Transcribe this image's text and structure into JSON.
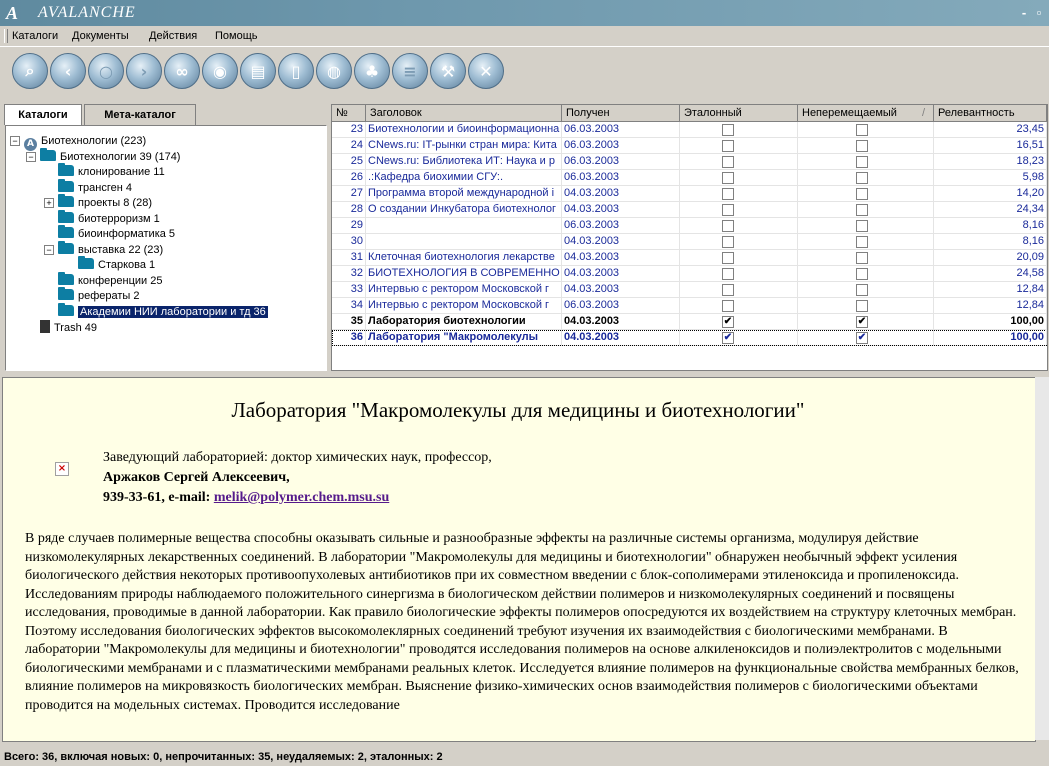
{
  "window": {
    "title": "AVALANCHE",
    "logo": "A",
    "minimize": "-",
    "restore": "▫"
  },
  "menu": [
    "Каталоги",
    "Документы",
    "Действия",
    "Помощь"
  ],
  "toolbar_icons": [
    "search-icon",
    "back-icon",
    "refresh-icon",
    "forward-icon",
    "link-icon",
    "record-icon",
    "document-list-icon",
    "page-icon",
    "globe-icon",
    "palm-icon",
    "stack-icon",
    "tools-icon",
    "close-icon"
  ],
  "tabs": [
    "Каталоги",
    "Мета-каталог"
  ],
  "tree": [
    {
      "label": "Биотехнологии (223)",
      "level": 0,
      "toggle": "−",
      "icon": "avalanche-icon"
    },
    {
      "label": "Биотехнологии 39 (174)",
      "level": 1,
      "toggle": "−",
      "icon": "folder-icon"
    },
    {
      "label": "клонирование 11",
      "level": 2,
      "toggle": "",
      "icon": "folder-icon"
    },
    {
      "label": "трансген 4",
      "level": 2,
      "toggle": "",
      "icon": "folder-icon"
    },
    {
      "label": "проекты 8 (28)",
      "level": 2,
      "toggle": "+",
      "icon": "folder-icon"
    },
    {
      "label": "биотерроризм 1",
      "level": 2,
      "toggle": "",
      "icon": "folder-icon"
    },
    {
      "label": "биоинформатика 5",
      "level": 2,
      "toggle": "",
      "icon": "folder-icon"
    },
    {
      "label": "выставка 22 (23)",
      "level": 2,
      "toggle": "−",
      "icon": "folder-icon"
    },
    {
      "label": "Старкова 1",
      "level": 3,
      "toggle": "",
      "icon": "folder-icon"
    },
    {
      "label": "конференции 25",
      "level": 2,
      "toggle": "",
      "icon": "folder-icon"
    },
    {
      "label": "рефераты 2",
      "level": 2,
      "toggle": "",
      "icon": "folder-icon"
    },
    {
      "label": "Академии  НИИ лаборатории и тд 36",
      "level": 2,
      "toggle": "",
      "icon": "folder-icon",
      "selected": true
    },
    {
      "label": "Trash 49",
      "level": 1,
      "toggle": "",
      "icon": "trash-icon"
    }
  ],
  "grid": {
    "columns": [
      "№",
      "Заголовок",
      "Получен",
      "Эталонный",
      "Неперемещаемый",
      "Релевантность"
    ],
    "sort_indicator": "/",
    "rows": [
      {
        "n": "23",
        "title": "Биотехнологии и биоинформационна",
        "date": "06.03.2003",
        "etalon": false,
        "fixed": false,
        "rel": "23,45",
        "bold": false
      },
      {
        "n": "24",
        "title": "CNews.ru: IT-рынки стран мира: Кита",
        "date": "06.03.2003",
        "etalon": false,
        "fixed": false,
        "rel": "16,51",
        "bold": false
      },
      {
        "n": "25",
        "title": "CNews.ru: Библиотека ИТ: Наука и р",
        "date": "06.03.2003",
        "etalon": false,
        "fixed": false,
        "rel": "18,23",
        "bold": false
      },
      {
        "n": "26",
        "title": ".:Кафедра биохимии СГУ:.",
        "date": "06.03.2003",
        "etalon": false,
        "fixed": false,
        "rel": "5,98",
        "bold": false
      },
      {
        "n": "27",
        "title": "Программа второй международной і",
        "date": "04.03.2003",
        "etalon": false,
        "fixed": false,
        "rel": "14,20",
        "bold": false
      },
      {
        "n": "28",
        "title": "О создании Инкубатора биотехнолог",
        "date": "04.03.2003",
        "etalon": false,
        "fixed": false,
        "rel": "24,34",
        "bold": false
      },
      {
        "n": "29",
        "title": "",
        "date": "06.03.2003",
        "etalon": false,
        "fixed": false,
        "rel": "8,16",
        "bold": false
      },
      {
        "n": "30",
        "title": "",
        "date": "04.03.2003",
        "etalon": false,
        "fixed": false,
        "rel": "8,16",
        "bold": false
      },
      {
        "n": "31",
        "title": "Клеточная биотехнология лекарстве",
        "date": "04.03.2003",
        "etalon": false,
        "fixed": false,
        "rel": "20,09",
        "bold": false
      },
      {
        "n": "32",
        "title": "БИОТЕХНОЛОГИЯ В СОВРЕМЕННО",
        "date": "04.03.2003",
        "etalon": false,
        "fixed": false,
        "rel": "24,58",
        "bold": false
      },
      {
        "n": "33",
        "title": "Интервью с ректором Московской г",
        "date": "04.03.2003",
        "etalon": false,
        "fixed": false,
        "rel": "12,84",
        "bold": false
      },
      {
        "n": "34",
        "title": "Интервью с ректором Московской г",
        "date": "06.03.2003",
        "etalon": false,
        "fixed": false,
        "rel": "12,84",
        "bold": false
      },
      {
        "n": "35",
        "title": "Лаборатория биотехнологии",
        "date": "04.03.2003",
        "etalon": true,
        "fixed": true,
        "rel": "100,00",
        "bold": true
      },
      {
        "n": "36",
        "title": "Лаборатория \"Макромолекулы",
        "date": "04.03.2003",
        "etalon": true,
        "fixed": true,
        "rel": "100,00",
        "bold": true,
        "current": true
      }
    ]
  },
  "document": {
    "title": "Лаборатория \"Макромолекулы для медицины и биотехнологии\"",
    "head_line": "Заведующий лабораторией: доктор химических наук, профессор,",
    "head_name": "Аржаков Сергей Алексеевич,",
    "contact_prefix": "939-33-61, e-mail: ",
    "email": "melik@polymer.chem.msu.su",
    "broken_image": "×",
    "body": "В ряде случаев полимерные вещества способны оказывать сильные и разнообразные эффекты на различные системы организма, модулируя действие низкомолекулярных лекарственных соединений. В лаборатории \"Макромолекулы для медицины и биотехнологии\" обнаружен необычный эффект усиления биологического действия некоторых противоопухолевых антибиотиков при их совместном введении с блок-сополимерами этиленоксида и пропиленоксида. Исследованиям природы наблюдаемого положительного синергизма в биологическом действии полимеров и низкомолекулярных соединений и посвящены исследования, проводимые в данной лаборатории. Как правило биологические эффекты полимеров опосредуются их воздействием на структуру клеточных мембран. Поэтому исследования биологических эффектов высокомолеклярных соединений требуют изучения их взаимодействия с биологическими мембранами. В лаборатории \"Макромолекулы для медицины и биотехнологии\" проводятся исследования полимеров на основе алкиленоксидов и полиэлектролитов с модельными биологическими мембранами и с плазматическими мембранами реальных клеток. Исследуется влияние полимеров на функциональные свойства мембранных белков, влияние полимеров на микровязкость биологических мембран. Выяснение физико-химических основ взаимодействия полимеров с биологическими объектами проводится на модельных системах. Проводится исследование"
  },
  "status": "Всего: 36, включая новых: 0, непрочитанных: 35, неудаляемых: 2, эталонных: 2"
}
